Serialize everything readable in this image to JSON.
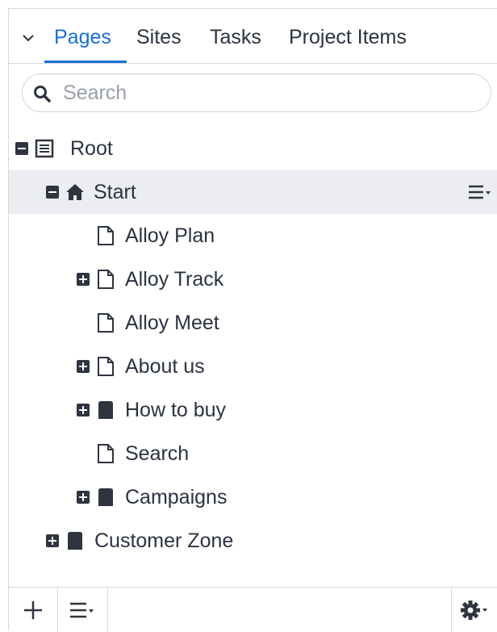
{
  "tabs": {
    "items": [
      {
        "label": "Pages",
        "active": true
      },
      {
        "label": "Sites",
        "active": false
      },
      {
        "label": "Tasks",
        "active": false
      },
      {
        "label": "Project Items",
        "active": false
      }
    ]
  },
  "search": {
    "placeholder": "Search",
    "value": ""
  },
  "tree": {
    "nodes": [
      {
        "label": "Root",
        "depth": 0,
        "toggle": "minus",
        "icon": "list-icon",
        "selected": false
      },
      {
        "label": "Start",
        "depth": 1,
        "toggle": "minus",
        "icon": "home-icon",
        "selected": true
      },
      {
        "label": "Alloy Plan",
        "depth": 2,
        "toggle": "none",
        "icon": "page-icon",
        "selected": false
      },
      {
        "label": "Alloy Track",
        "depth": 2,
        "toggle": "plus",
        "icon": "page-icon",
        "selected": false
      },
      {
        "label": "Alloy Meet",
        "depth": 2,
        "toggle": "none",
        "icon": "page-icon",
        "selected": false
      },
      {
        "label": "About us",
        "depth": 2,
        "toggle": "plus",
        "icon": "page-icon",
        "selected": false
      },
      {
        "label": "How to buy",
        "depth": 2,
        "toggle": "plus",
        "icon": "container-icon",
        "selected": false
      },
      {
        "label": "Search",
        "depth": 2,
        "toggle": "none",
        "icon": "page-icon",
        "selected": false
      },
      {
        "label": "Campaigns",
        "depth": 2,
        "toggle": "plus",
        "icon": "container-icon",
        "selected": false
      },
      {
        "label": "Customer Zone",
        "depth": 1,
        "toggle": "plus",
        "icon": "container-icon",
        "selected": false
      }
    ]
  },
  "colors": {
    "accent": "#1a6fd6",
    "selected_row": "#ebedf0",
    "border": "#d5d8dc",
    "text": "#2b3340"
  }
}
